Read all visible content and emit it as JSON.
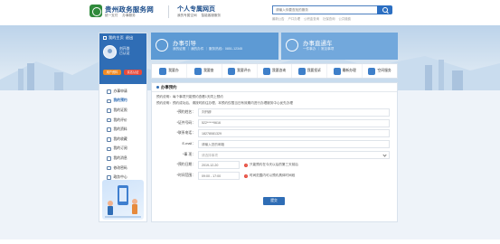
{
  "header": {
    "site_name": "贵州政务服务网",
    "site_links": [
      "统一支付",
      "办事服务"
    ],
    "space_title": "个人专属网页",
    "space_links": [
      "我的专属空间",
      "智能客服服务"
    ],
    "search_placeholder": "请输入你要查找的服务",
    "hot_words": [
      "最新公告",
      "户口办理",
      "公积金查询",
      "社保查询",
      "公共缴费"
    ]
  },
  "sidebar": {
    "title": "我的主页",
    "title_link": "退出",
    "user_name": "刘开辟",
    "user_status": "已认证",
    "btn_profile": "用户资料",
    "btn_certify": "实名认证",
    "items": [
      {
        "label": "办事申请"
      },
      {
        "label": "我的预约"
      },
      {
        "label": "我的证照"
      },
      {
        "label": "我的评价"
      },
      {
        "label": "我的资料"
      },
      {
        "label": "我的收藏"
      },
      {
        "label": "我的订阅"
      },
      {
        "label": "我的消息"
      },
      {
        "label": "修改密码"
      },
      {
        "label": "政务中心"
      }
    ]
  },
  "cards": {
    "mine_title": "办事引导",
    "mine_sub": "我的证照 ｜ 我的办件 ｜ 服务热线：0851-12345",
    "car_title": "办事直通车",
    "car_sub": "一件事办 ｜ 常见事项"
  },
  "quick_tabs": [
    {
      "label": "我要办"
    },
    {
      "label": "我要查"
    },
    {
      "label": "我要评价"
    },
    {
      "label": "我要咨询"
    },
    {
      "label": "我要投诉"
    },
    {
      "label": "最新办理"
    },
    {
      "label": "空间服务"
    }
  ],
  "form": {
    "title": "办事预约",
    "notice_1": "预约说明：每个事项只能预约查看1天同上预约",
    "notice_2": "预约说明：预约成功后，请按时前往办理，本预约仅限当日有效期内进行办理服务中心优先办理",
    "fields": {
      "name_label": "*预约姓名：",
      "name_value": "刘开辟",
      "id_label": "*证件号码：",
      "id_value": "522*****9616",
      "phone_label": "*联系电话：",
      "phone_value": "18278081329",
      "email_label": "E-mail：",
      "email_placeholder": "请输入您的邮箱",
      "item_label": "*事 项：",
      "item_placeholder": "请选择事项",
      "date_label": "*预约日期：",
      "date_value": "2019-12-20",
      "date_hint": "只能预约在今天以后的第三天前后",
      "time_label": "*时间范围：",
      "time_value": "09:00 - 17:00",
      "time_hint": "时间范围内可以预约具体时间段"
    },
    "submit_label": "提交"
  }
}
